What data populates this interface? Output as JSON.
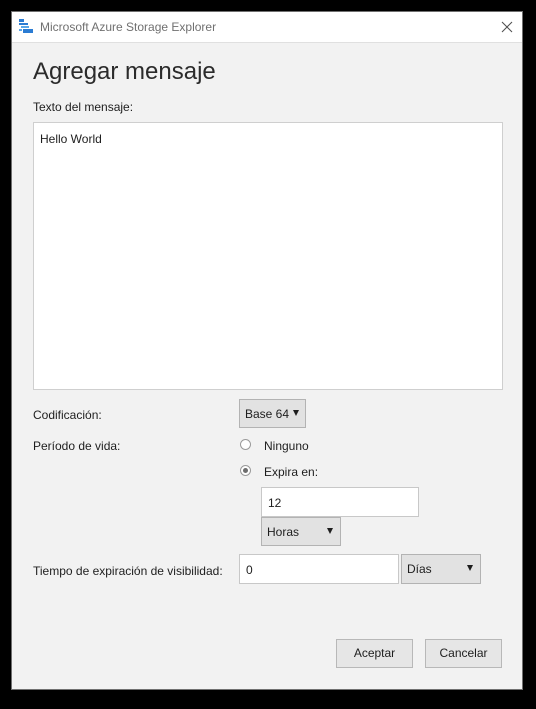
{
  "window": {
    "title": "Microsoft Azure Storage Explorer"
  },
  "dialog": {
    "heading": "Agregar mensaje",
    "message_label": "Texto del mensaje:",
    "message_value": "Hello World",
    "encoding_label": "Codificación:",
    "encoding_value": "Base 64",
    "ttl_label": "Período de vida:",
    "ttl_option_none": "Ninguno",
    "ttl_option_expires": "Expira en:",
    "ttl_selected": "Expira en:",
    "ttl_amount": "12",
    "ttl_unit": "Horas",
    "visibility_label": "Tiempo de expiración de visibilidad:",
    "visibility_amount": "0",
    "visibility_unit": "Días",
    "ok_label": "Aceptar",
    "cancel_label": "Cancelar"
  },
  "icons": {
    "app": "azure-storage-explorer-icon",
    "close": "close-icon",
    "dropdown": "triangle-down-icon"
  },
  "colors": {
    "accent": "#2b7cd3",
    "dialog_bg": "#f2f2f2",
    "button_bg": "#e6e6e6"
  }
}
